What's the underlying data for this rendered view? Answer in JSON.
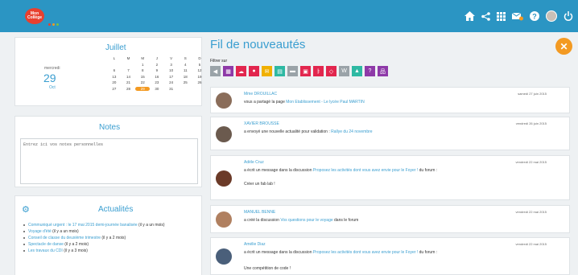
{
  "header": {
    "logo_line1": "Mon",
    "logo_line2": "Collège",
    "dot_colors": [
      "#e8402f",
      "#f39a22",
      "#7ac143"
    ],
    "icons": [
      "home-icon",
      "share-icon",
      "apps-grid-icon",
      "messages-icon",
      "help-icon",
      "user-avatar",
      "logout-icon"
    ],
    "bar_color": "#2b95c3"
  },
  "calendar": {
    "month": "Juillet",
    "day_name": "mercredi",
    "day_number": "29",
    "day_month": "Oct",
    "weekdays": [
      "L",
      "M",
      "M",
      "J",
      "V",
      "S",
      "D"
    ],
    "rows": [
      [
        "",
        "",
        "1",
        "2",
        "3",
        "4",
        "5"
      ],
      [
        "6",
        "7",
        "8",
        "9",
        "10",
        "11",
        "12"
      ],
      [
        "13",
        "14",
        "15",
        "16",
        "17",
        "18",
        "19"
      ],
      [
        "20",
        "21",
        "22",
        "23",
        "24",
        "25",
        "26"
      ],
      [
        "27",
        "28",
        "29",
        "30",
        "31",
        "",
        ""
      ]
    ],
    "today": "29"
  },
  "notes": {
    "title": "Notes",
    "placeholder": "Entrez ici vos notes personnelles"
  },
  "actualites": {
    "title": "Actualités",
    "items": [
      {
        "text": "Communiqué urgent : le 17 mai 2015 demi-journée banalisée",
        "age": "(il y a un mois)"
      },
      {
        "text": "Voyage d'été",
        "age": "(il y a un mois)"
      },
      {
        "text": "Conseil de classe du deuxième trimestre",
        "age": "(il y a 2 mois)"
      },
      {
        "text": "Spectacle de danse",
        "age": "(il y a 2 mois)"
      },
      {
        "text": "Les travaux du CDI",
        "age": "(il y a 3 mois)"
      }
    ]
  },
  "feed": {
    "title": "Fil de nouveautés",
    "filter_label": "Filtrer sur",
    "add_button": "+",
    "filters": [
      {
        "name": "filter-megaphone-icon",
        "color": "#9aa3a8",
        "glyph": "◀"
      },
      {
        "name": "filter-calendar-icon",
        "color": "#8e3aa8",
        "glyph": "▦"
      },
      {
        "name": "filter-cloud-icon",
        "color": "#e2264e",
        "glyph": "☁"
      },
      {
        "name": "filter-chat-icon",
        "color": "#e2264e",
        "glyph": "●"
      },
      {
        "name": "filter-mail-icon",
        "color": "#f0b000",
        "glyph": "✉"
      },
      {
        "name": "filter-grid-icon",
        "color": "#2eb9a3",
        "glyph": "▤"
      },
      {
        "name": "filter-folder-icon",
        "color": "#9aa3a8",
        "glyph": "▬"
      },
      {
        "name": "filter-bus-icon",
        "color": "#e2264e",
        "glyph": "▣"
      },
      {
        "name": "filter-tree-icon",
        "color": "#e2264e",
        "glyph": "ㅑ"
      },
      {
        "name": "filter-tag-icon",
        "color": "#e2264e",
        "glyph": "◇"
      },
      {
        "name": "filter-wiki-icon",
        "color": "#9aa3a8",
        "glyph": "W"
      },
      {
        "name": "filter-contact-icon",
        "color": "#2eb9a3",
        "glyph": "▲"
      },
      {
        "name": "filter-help-icon",
        "color": "#8e3aa8",
        "glyph": "?"
      },
      {
        "name": "filter-network-icon",
        "color": "#8e3aa8",
        "glyph": "品"
      }
    ],
    "posts": [
      {
        "author": "Mme DROUILLAC",
        "date": "samedi 27 juin 2015",
        "action": "vous a partagé la page",
        "link": "Mon Etablissement - Le lycée Paul MARTIN",
        "suffix": "",
        "extra": ""
      },
      {
        "author": "XAVIER BROUSSE",
        "date": "vendredi 26 juin 2015",
        "action": "a envoyé une nouvelle actualité pour validation :",
        "link": "Rallye du 24 novembre",
        "suffix": "",
        "extra": ""
      },
      {
        "author": "Adèle Cruz",
        "date": "vendredi 22 mai 2015",
        "action": "a écrit un message dans la discussion",
        "link": "Proposez les activités dont vous avez envie pour le Foyer !",
        "suffix": "du forum :",
        "extra": "Créer un fab lab !"
      },
      {
        "author": "MANUEL BENNE",
        "date": "vendredi 22 mai 2015",
        "action": "a créé la discussion",
        "link": "Vos questions pour le voyage",
        "suffix": "dans le forum",
        "extra": ""
      },
      {
        "author": "Amélie Diaz",
        "date": "vendredi 22 mai 2015",
        "action": "a écrit un message dans la discussion",
        "link": "Proposez les activités dont vous avez envie pour le Foyer !",
        "suffix": "du forum :",
        "extra": "Une compétition de code !"
      }
    ]
  }
}
